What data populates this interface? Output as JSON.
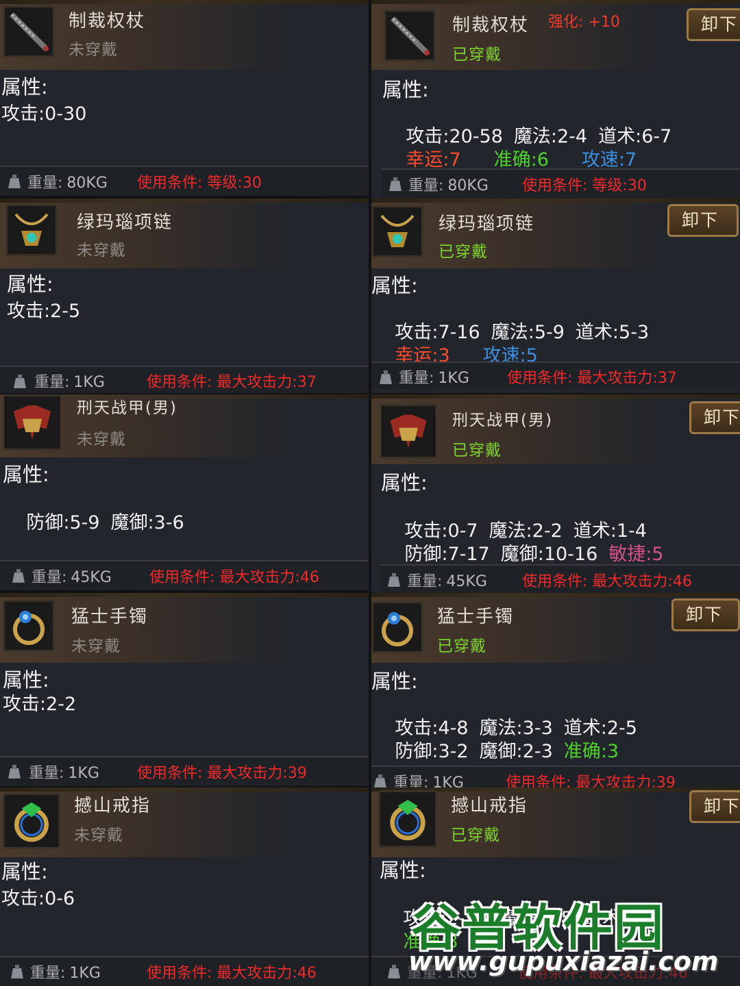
{
  "labels": {
    "attributes": "属性:",
    "weight": "重量:",
    "unequip": "卸下",
    "enhance": "强化: +10"
  },
  "cards": [
    {
      "name": "制裁权杖",
      "state": "未穿戴",
      "icon": "staff-icon",
      "lines": [
        [
          {
            "t": "攻击:0-30",
            "c": ""
          }
        ]
      ],
      "weight": "80KG",
      "condition": "使用条件: 等级:30"
    },
    {
      "name": "制裁权杖",
      "state": "已穿戴",
      "icon": "staff-icon",
      "lines": [
        [
          {
            "t": "攻击:20-58",
            "c": ""
          },
          {
            "t": "魔法:2-4",
            "c": ""
          },
          {
            "t": "道术:6-7",
            "c": ""
          }
        ],
        [
          {
            "t": "幸运:7",
            "c": "red"
          },
          {
            "t": "准确:6",
            "c": "green"
          },
          {
            "t": "攻速:7",
            "c": "blue"
          }
        ]
      ],
      "weight": "80KG",
      "condition": "使用条件: 等级:30"
    },
    {
      "name": "绿玛瑙项链",
      "state": "未穿戴",
      "icon": "necklace-icon",
      "lines": [
        [
          {
            "t": "攻击:2-5",
            "c": ""
          }
        ]
      ],
      "weight": "1KG",
      "condition": "使用条件: 最大攻击力:37"
    },
    {
      "name": "绿玛瑙项链",
      "state": "已穿戴",
      "icon": "necklace-icon",
      "lines": [
        [
          {
            "t": "攻击:7-16",
            "c": ""
          },
          {
            "t": "魔法:5-9",
            "c": ""
          },
          {
            "t": "道术:5-3",
            "c": ""
          }
        ],
        [
          {
            "t": "幸运:3",
            "c": "red"
          },
          {
            "t": "攻速:5",
            "c": "blue"
          }
        ]
      ],
      "weight": "1KG",
      "condition": "使用条件: 最大攻击力:37"
    },
    {
      "name": "刑天战甲(男)",
      "state": "未穿戴",
      "icon": "armor-icon",
      "lines": [
        [
          {
            "t": "防御:5-9",
            "c": ""
          },
          {
            "t": "魔御:3-6",
            "c": ""
          }
        ]
      ],
      "weight": "45KG",
      "condition": "使用条件: 最大攻击力:46"
    },
    {
      "name": "刑天战甲(男)",
      "state": "已穿戴",
      "icon": "armor-icon",
      "lines": [
        [
          {
            "t": "攻击:0-7",
            "c": ""
          },
          {
            "t": "魔法:2-2",
            "c": ""
          },
          {
            "t": "道术:1-4",
            "c": ""
          }
        ],
        [
          {
            "t": "防御:7-17",
            "c": ""
          },
          {
            "t": "魔御:10-16",
            "c": ""
          },
          {
            "t": "敏捷:5",
            "c": "pink"
          }
        ]
      ],
      "weight": "45KG",
      "condition": "使用条件: 最大攻击力:46"
    },
    {
      "name": "猛士手镯",
      "state": "未穿戴",
      "icon": "bracelet-icon",
      "lines": [
        [
          {
            "t": "攻击:2-2",
            "c": ""
          }
        ]
      ],
      "weight": "1KG",
      "condition": "使用条件: 最大攻击力:39"
    },
    {
      "name": "猛士手镯",
      "state": "已穿戴",
      "icon": "bracelet-icon",
      "lines": [
        [
          {
            "t": "攻击:4-8",
            "c": ""
          },
          {
            "t": "魔法:3-3",
            "c": ""
          },
          {
            "t": "道术:2-5",
            "c": ""
          }
        ],
        [
          {
            "t": "防御:3-2",
            "c": ""
          },
          {
            "t": "魔御:2-3",
            "c": ""
          },
          {
            "t": "准确:3",
            "c": "green"
          }
        ]
      ],
      "weight": "1KG",
      "condition": "使用条件: 最大攻击力:39"
    },
    {
      "name": "撼山戒指",
      "state": "未穿戴",
      "icon": "ring-icon",
      "lines": [
        [
          {
            "t": "攻击:0-6",
            "c": ""
          }
        ]
      ],
      "weight": "1KG",
      "condition": "使用条件: 最大攻击力:46"
    },
    {
      "name": "撼山戒指",
      "state": "已穿戴",
      "icon": "ring-icon",
      "lines": [
        [
          {
            "t": "攻击:2-15",
            "c": ""
          },
          {
            "t": "魔法:2-5",
            "c": ""
          },
          {
            "t": "道术:7-2",
            "c": ""
          }
        ],
        [
          {
            "t": "准确:3",
            "c": "green"
          }
        ]
      ],
      "weight": "1KG",
      "condition": "使用条件: 最大攻击力:46"
    }
  ],
  "watermark": {
    "title": "谷普软件园",
    "url": "www.gupuxiazai.com"
  }
}
